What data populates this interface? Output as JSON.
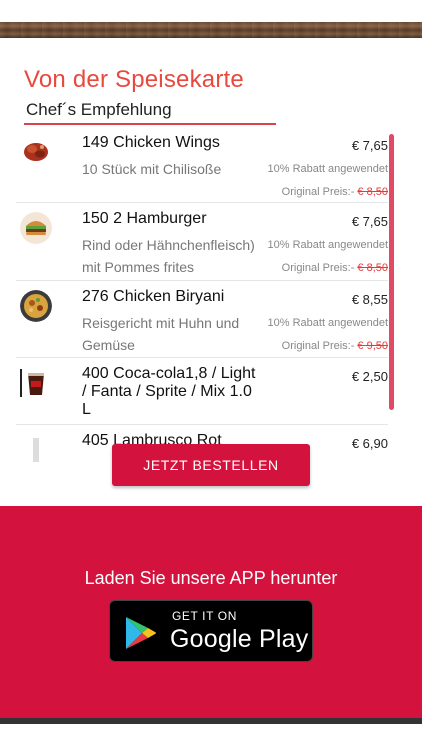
{
  "section": {
    "title": "Von der Speisekarte",
    "subtitle": "Chef´s Empfehlung"
  },
  "items": [
    {
      "name": "149  Chicken Wings",
      "desc": "10 Stück mit Chilisoße",
      "price": "€ 7,65",
      "rabatt": "10% Rabatt angewendet",
      "orig_label": "Original Preis:-",
      "orig_price": "€ 8,50",
      "icon": "chicken-wings-icon"
    },
    {
      "name": "150  2 Hamburger",
      "desc": "Rind oder Hähnchenfleisch) mit Pommes frites",
      "price": "€ 7,65",
      "rabatt": "10% Rabatt angewendet",
      "orig_label": "Original Preis:-",
      "orig_price": "€ 8,50",
      "icon": "hamburger-icon"
    },
    {
      "name": "276  Chicken Biryani",
      "desc": "Reisgericht mit Huhn und Gemüse",
      "price": "€ 8,55",
      "rabatt": "10% Rabatt angewendet",
      "orig_label": "Original Preis:-",
      "orig_price": "€ 9,50",
      "icon": "biryani-icon"
    },
    {
      "name": "400 Coca-cola1,8 / Light / Fanta / Sprite / Mix 1.0 L",
      "price": "€ 2,50",
      "icon": "cola-glass-icon"
    },
    {
      "name": "405 Lambrusco Rot",
      "price": "€ 6,90",
      "icon": "wine-bottle-icon"
    }
  ],
  "order_button": "JETZT BESTELLEN",
  "footer": {
    "text": "Laden Sie unsere APP herunter",
    "badge_small": "GET IT ON",
    "badge_big": "Google Play"
  },
  "colors": {
    "accent_red": "#d4123e",
    "title_red": "#e8493f",
    "scrollbar": "#e04a64"
  }
}
